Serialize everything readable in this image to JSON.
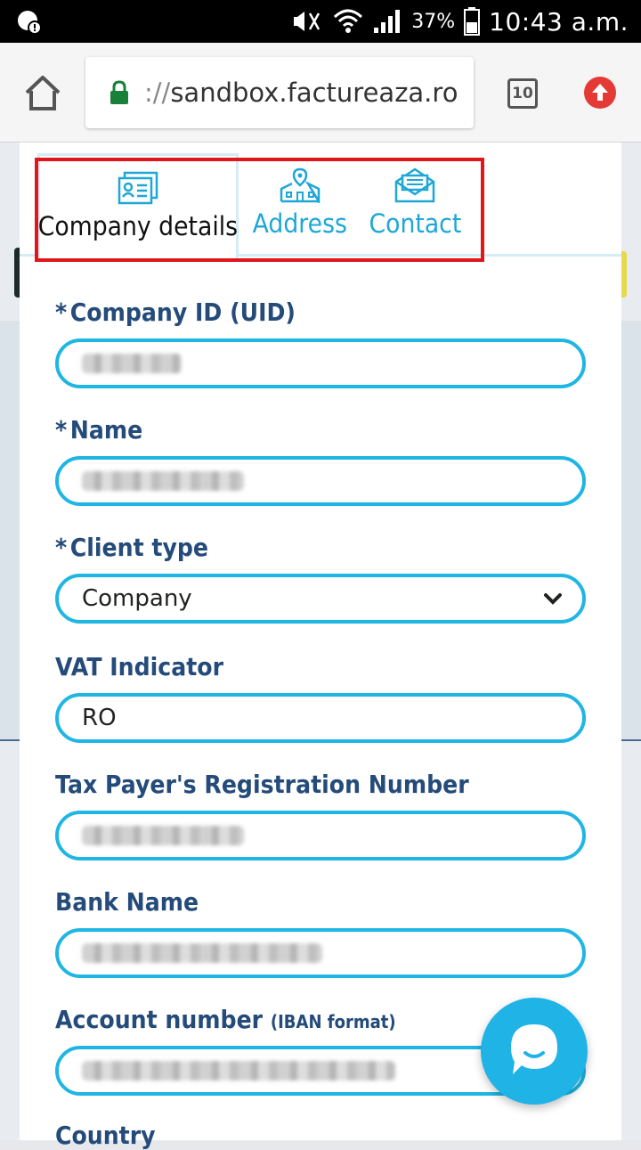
{
  "status_bar": {
    "battery_percent": "37%",
    "time": "10:43 a.m."
  },
  "browser": {
    "url_scheme": "://",
    "url_host": "sandbox.factureaza.ro",
    "tab_count": "10"
  },
  "tabs": [
    {
      "label": "Company details",
      "icon": "id-card-icon",
      "active": true
    },
    {
      "label": "Address",
      "icon": "location-building-icon",
      "active": false
    },
    {
      "label": "Contact",
      "icon": "envelope-icon",
      "active": false
    }
  ],
  "form": {
    "company_id": {
      "label": "Company ID (UID)",
      "required": "*"
    },
    "name": {
      "label": "Name",
      "required": "*"
    },
    "client_type": {
      "label": "Client type",
      "required": "*",
      "value": "Company"
    },
    "vat_indicator": {
      "label": "VAT Indicator",
      "value": "RO"
    },
    "tax_payer_reg": {
      "label": "Tax Payer's Registration Number"
    },
    "bank_name": {
      "label": "Bank Name"
    },
    "account_number": {
      "label": "Account number",
      "hint": "(IBAN format)"
    },
    "country": {
      "label": "Country"
    }
  },
  "colors": {
    "accent": "#1fb6e3",
    "label": "#244b7a",
    "highlight": "#e0161b"
  }
}
